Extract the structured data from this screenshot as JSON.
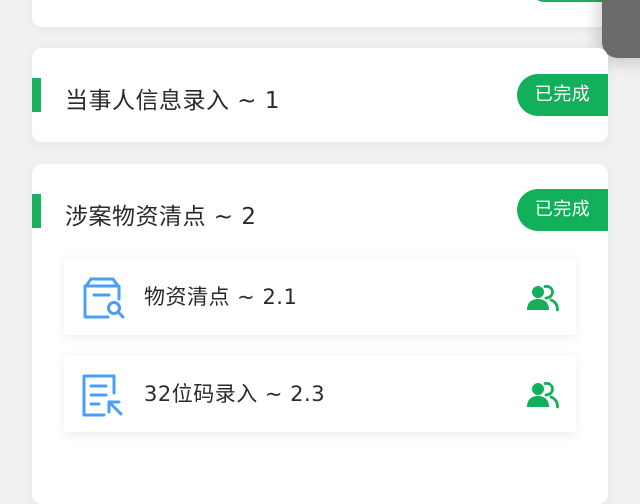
{
  "colors": {
    "accent_green": "#1db05c",
    "badge_green": "#12b05a",
    "icon_blue": "#4a9ff5",
    "page_bg": "#f1f1f1"
  },
  "sections": [
    {
      "title": "当事人信息录入 ~ 1",
      "status": "已完成"
    },
    {
      "title": "涉案物资清点 ~ 2",
      "status": "已完成",
      "items": [
        {
          "label": "物资清点 ~ 2.1",
          "icon": "box-search-icon",
          "action_icon": "users-icon"
        },
        {
          "label": "32位码录入 ~ 2.3",
          "icon": "form-entry-icon",
          "action_icon": "users-icon"
        }
      ]
    }
  ]
}
